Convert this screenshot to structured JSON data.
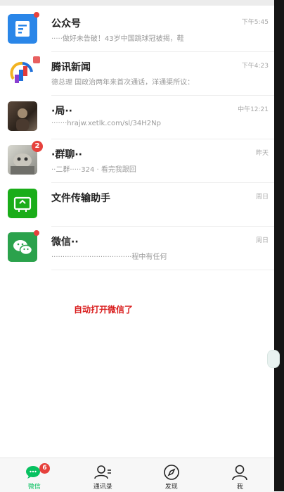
{
  "colors": {
    "accent_green": "#07c160",
    "badge_red": "#e6413c",
    "note_red": "#d91c1c"
  },
  "chats": [
    {
      "title": "公众号",
      "preview": "·····做好未告破！43岁中国跳球冠被揭，鞋",
      "time": "下午5:45",
      "icon": "official-accounts-icon",
      "indicator": "dot"
    },
    {
      "title": "腾讯新闻",
      "preview": "德总理 国政治两年来首次通话，洋通渠所议：",
      "time": "下午4:23",
      "icon": "tencent-news-logo",
      "indicator": "none"
    },
    {
      "title": "·局··",
      "preview": "·······hrajw.xetlk.com/sl/34H2Np",
      "time": "中午12:21",
      "icon": "user-avatar",
      "indicator": "none"
    },
    {
      "title": "·群聊··",
      "preview": "··二群·····324 · 看完我跟回",
      "time": "昨天",
      "icon": "group-avatar",
      "indicator": "2"
    },
    {
      "title": "文件传输助手",
      "preview": "",
      "time": "周日",
      "icon": "file-transfer-icon",
      "indicator": "none"
    },
    {
      "title": "微信··",
      "preview": "····································程中有任何",
      "time": "周日",
      "icon": "wechat-icon",
      "indicator": "dot"
    }
  ],
  "overlay_note": "自动打开微信了",
  "tabs": [
    {
      "label": "微信",
      "icon": "chat-icon",
      "badge": "6",
      "active": true
    },
    {
      "label": "通讯录",
      "icon": "contacts-icon",
      "badge": "",
      "active": false
    },
    {
      "label": "发现",
      "icon": "discover-icon",
      "badge": "",
      "active": false
    },
    {
      "label": "我",
      "icon": "me-icon",
      "badge": "",
      "active": false
    }
  ]
}
